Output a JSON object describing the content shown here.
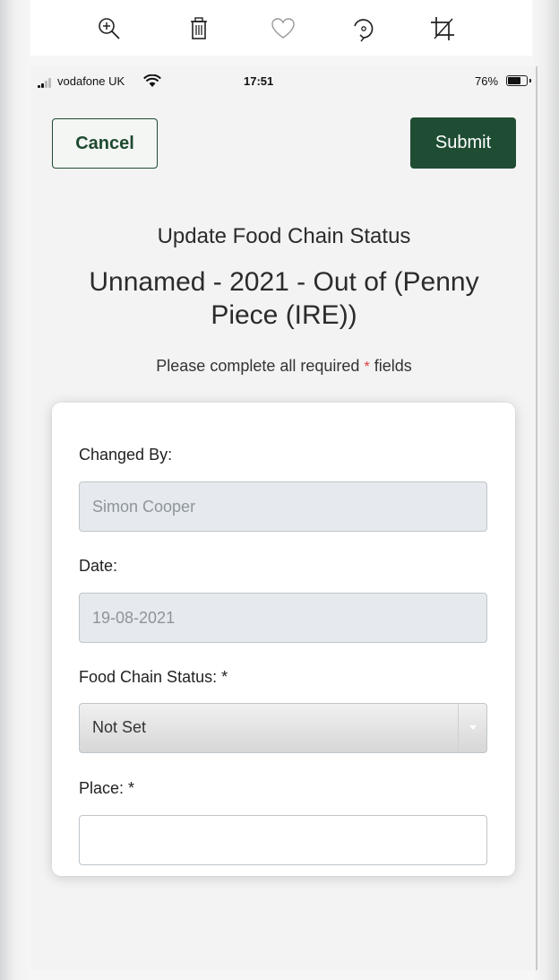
{
  "toolbar": {
    "icons": [
      "zoom-in-icon",
      "trash-icon",
      "heart-icon",
      "rotate-icon",
      "crop-icon"
    ]
  },
  "status_bar": {
    "carrier": "vodafone UK",
    "time": "17:51",
    "battery": "76%",
    "battery_level": 0.76
  },
  "header": {
    "cancel_label": "Cancel",
    "submit_label": "Submit"
  },
  "page": {
    "subtitle": "Update Food Chain Status",
    "title": "Unnamed - 2021 - Out of (Penny Piece (IRE))",
    "note_before": "Please complete all required",
    "note_marker": "*",
    "note_after": "fields"
  },
  "form": {
    "changed_by_label": "Changed By:",
    "changed_by_value": "Simon Cooper",
    "date_label": "Date:",
    "date_value": "19-08-2021",
    "status_label": "Food Chain Status: *",
    "status_value": "Not Set",
    "place_label": "Place: *",
    "place_value": ""
  },
  "colors": {
    "brand_green": "#1e4d33",
    "required_red": "#e03b3b"
  }
}
